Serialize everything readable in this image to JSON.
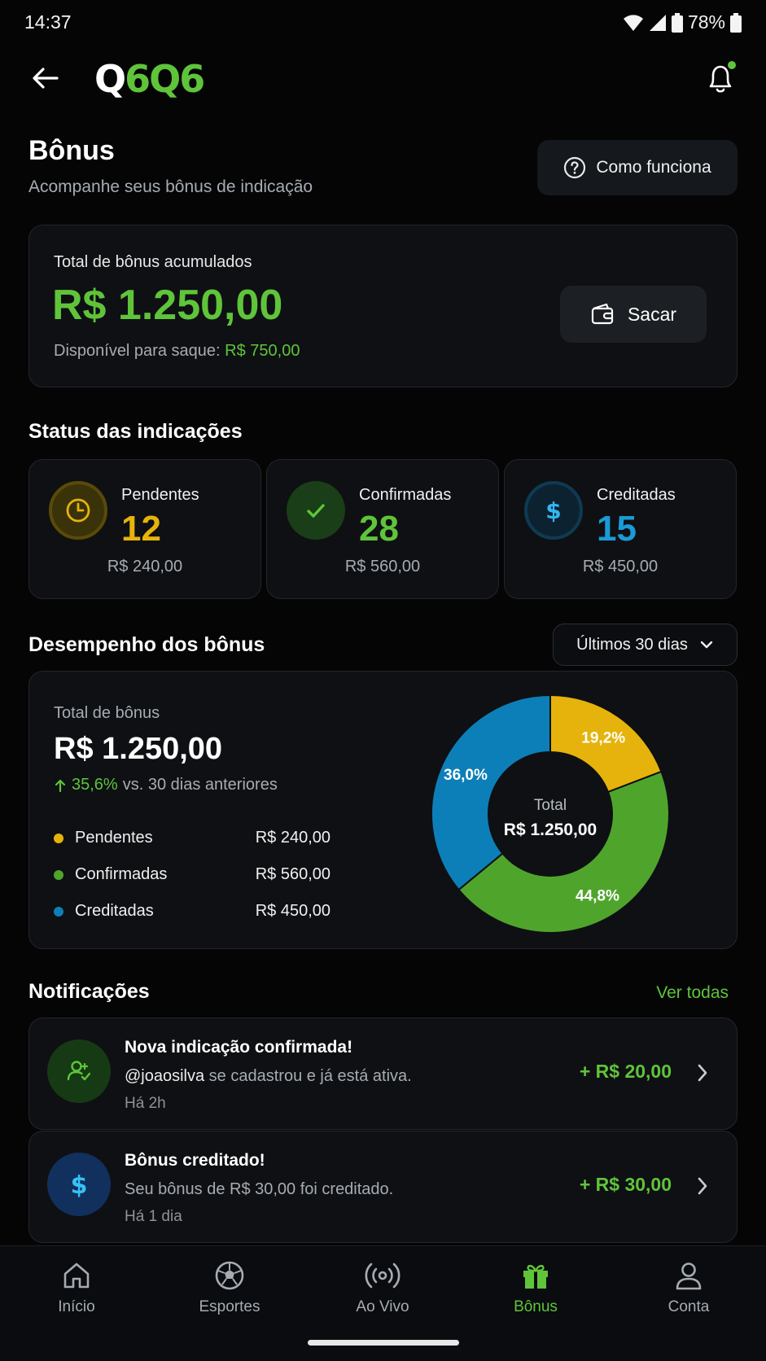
{
  "status_bar": {
    "time": "14:37",
    "battery": "78%"
  },
  "header": {
    "logo_a": "Q",
    "logo_b": "6",
    "logo_c": "Q",
    "logo_d": "6"
  },
  "page": {
    "title": "Bônus",
    "subtitle": "Acompanhe seus bônus de indicação",
    "how_button": "Como funciona"
  },
  "total_card": {
    "label": "Total de bônus acumulados",
    "value": "R$ 1.250,00",
    "available_label": "Disponível para saque:",
    "available_value": "R$ 750,00",
    "withdraw_button": "Sacar"
  },
  "status_section": {
    "title": "Status das indicações",
    "cards": [
      {
        "label": "Pendentes",
        "count": "12",
        "amount": "R$ 240,00",
        "color": "#e5b30c",
        "icon": "clock-icon"
      },
      {
        "label": "Confirmadas",
        "count": "28",
        "amount": "R$ 560,00",
        "color": "#5fc43a",
        "icon": "check-icon"
      },
      {
        "label": "Creditadas",
        "count": "15",
        "amount": "R$ 450,00",
        "color": "#1a9bd7",
        "icon": "dollar-icon"
      }
    ]
  },
  "performance": {
    "title": "Desempenho dos bônus",
    "period": "Últimos 30 dias",
    "total_label": "Total de bônus",
    "total_value": "R$ 1.250,00",
    "change_pct": "35,6%",
    "change_text": "vs. 30 dias anteriores",
    "legend": [
      {
        "label": "Pendentes",
        "amount": "R$ 240,00",
        "color": "#e5b30c"
      },
      {
        "label": "Confirmadas",
        "amount": "R$ 560,00",
        "color": "#4fa52c"
      },
      {
        "label": "Creditadas",
        "amount": "R$ 450,00",
        "color": "#0d7fb8"
      }
    ],
    "donut_center_label": "Total",
    "donut_center_value": "R$ 1.250,00"
  },
  "chart_data": {
    "type": "pie",
    "categories": [
      "Pendentes",
      "Confirmadas",
      "Creditadas"
    ],
    "values": [
      19.2,
      44.8,
      36.0
    ],
    "labels": [
      "19,2%",
      "44,8%",
      "36,0%"
    ],
    "colors": [
      "#e5b30c",
      "#4fa52c",
      "#0d7fb8"
    ]
  },
  "notifications": {
    "title": "Notificações",
    "see_all": "Ver todas",
    "items": [
      {
        "title": "Nova indicação confirmada!",
        "user": "@joaosilva",
        "body": " se cadastrou e já está ativa.",
        "time": "Há 2h",
        "amount": "+ R$ 20,00",
        "icon": "user-add-icon"
      },
      {
        "title": "Bônus creditado!",
        "user": "",
        "body": "Seu bônus de R$ 30,00 foi creditado.",
        "time": "Há 1 dia",
        "amount": "+ R$ 30,00",
        "icon": "dollar-icon"
      }
    ]
  },
  "tabbar": [
    {
      "label": "Início",
      "icon": "home-icon"
    },
    {
      "label": "Esportes",
      "icon": "soccer-ball-icon"
    },
    {
      "label": "Ao Vivo",
      "icon": "broadcast-icon"
    },
    {
      "label": "Bônus",
      "icon": "gift-icon",
      "active": true
    },
    {
      "label": "Conta",
      "icon": "user-icon"
    }
  ]
}
